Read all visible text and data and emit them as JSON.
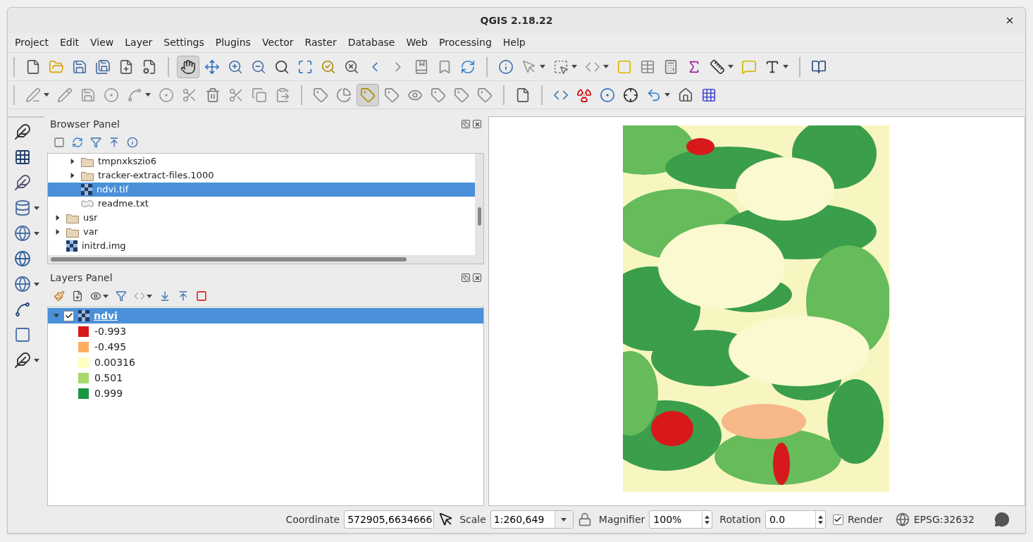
{
  "window": {
    "title": "QGIS 2.18.22"
  },
  "menu": [
    "Project",
    "Edit",
    "View",
    "Layer",
    "Settings",
    "Plugins",
    "Vector",
    "Raster",
    "Database",
    "Web",
    "Processing",
    "Help"
  ],
  "browser_panel": {
    "title": "Browser Panel",
    "items": [
      {
        "children": [
          {
            "label": "tmpnxkszio6",
            "kind": "folder",
            "expanded": false,
            "selected": false
          },
          {
            "label": "tracker-extract-files.1000",
            "kind": "folder",
            "expanded": false,
            "selected": false
          },
          {
            "label": "ndvi.tif",
            "kind": "raster",
            "selected": true
          },
          {
            "label": "readme.txt",
            "kind": "file",
            "selected": false
          }
        ]
      },
      {
        "label": "usr",
        "kind": "folder",
        "expanded": false,
        "selected": false
      },
      {
        "label": "var",
        "kind": "folder",
        "expanded": false,
        "selected": false
      },
      {
        "label": "initrd.img",
        "kind": "raster",
        "selected": false
      }
    ]
  },
  "layers_panel": {
    "title": "Layers Panel",
    "layers": [
      {
        "name": "ndvi",
        "checked": true,
        "expanded": true,
        "selected": true,
        "legend": [
          {
            "label": "-0.993",
            "color": "#d7191c"
          },
          {
            "label": "-0.495",
            "color": "#fdae61"
          },
          {
            "label": "0.00316",
            "color": "#ffffbf"
          },
          {
            "label": "0.501",
            "color": "#a6d96a"
          },
          {
            "label": "0.999",
            "color": "#1a9641"
          }
        ]
      }
    ]
  },
  "status_bar": {
    "coordinate_label": "Coordinate",
    "coordinate": "572905,6634666",
    "scale_label": "Scale",
    "scale": "1:260,649",
    "magnifier_label": "Magnifier",
    "magnifier": "100%",
    "rotation_label": "Rotation",
    "rotation": "0.0",
    "render_label": "Render",
    "render": true,
    "crs": "EPSG:32632"
  }
}
